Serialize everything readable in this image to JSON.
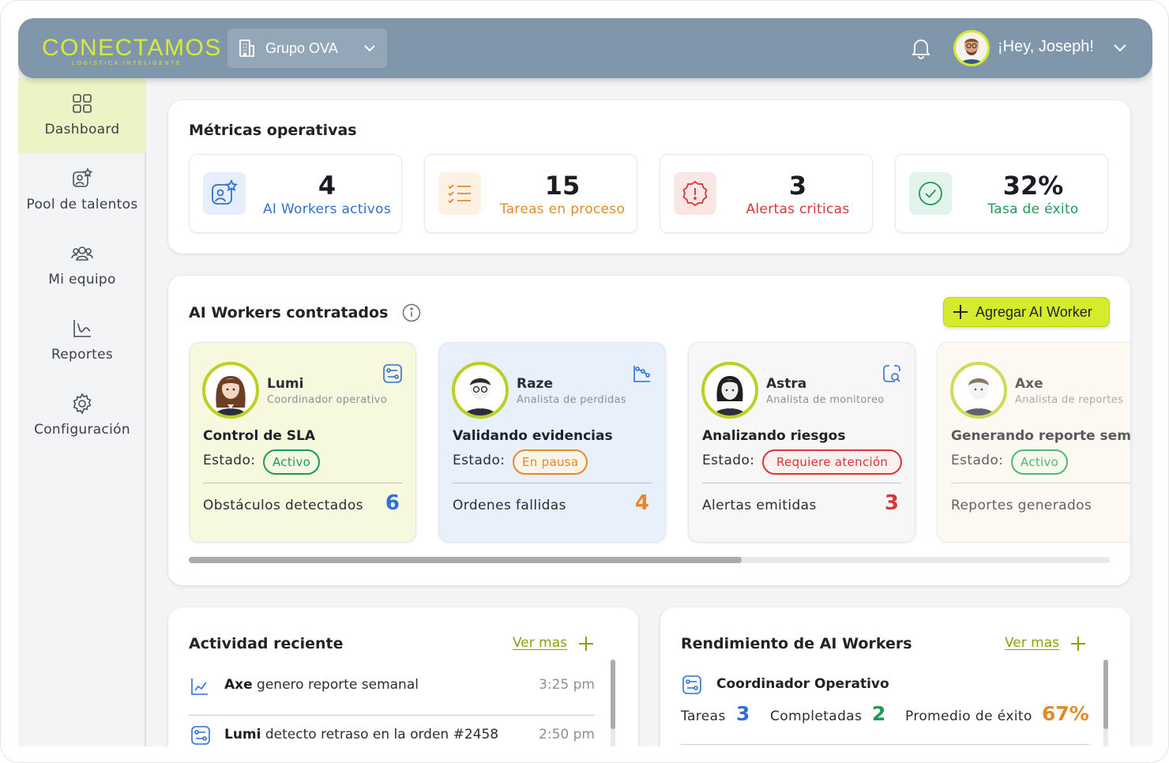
{
  "header": {
    "logo_text": "CONECTAMOS",
    "logo_tagline": "LOGISTICA INTELIGENTE",
    "org_name": "Grupo OVA",
    "greeting": "¡Hey, Joseph!"
  },
  "sidebar": {
    "items": [
      {
        "label": "Dashboard",
        "icon": "grid-icon",
        "active": true
      },
      {
        "label": "Pool de talentos",
        "icon": "user-star-icon",
        "active": false
      },
      {
        "label": "Mi equipo",
        "icon": "team-icon",
        "active": false
      },
      {
        "label": "Reportes",
        "icon": "chart-line-icon",
        "active": false
      },
      {
        "label": "Configuración",
        "icon": "gear-icon",
        "active": false
      }
    ]
  },
  "metrics": {
    "title": "Métricas operativas",
    "items": [
      {
        "value": "4",
        "label": "AI Workers activos",
        "color": "#2f6fd6",
        "icon": "user-star-icon"
      },
      {
        "value": "15",
        "label": "Tareas en proceso",
        "color": "#e58a2a",
        "icon": "checklist-icon"
      },
      {
        "value": "3",
        "label": "Alertas criticas",
        "color": "#d93636",
        "icon": "alert-badge-icon"
      },
      {
        "value": "32%",
        "label": "Tasa de éxito",
        "color": "#1f9a56",
        "icon": "check-circle-icon"
      }
    ]
  },
  "workers": {
    "title": "AI Workers contratados",
    "add_label": "Agregar AI Worker",
    "items": [
      {
        "name": "Lumi",
        "role": "Coordinador operativo",
        "task": "Control de SLA",
        "estado_label": "Estado:",
        "status": "Activo",
        "status_color": "#1f9a56",
        "stat_label": "Obstáculos detectados",
        "stat_value": "6",
        "stat_color": "#2f6fd6",
        "bg": "#f6f9de"
      },
      {
        "name": "Raze",
        "role": "Analista de perdidas",
        "task": "Validando evidencias",
        "estado_label": "Estado:",
        "status": "En pausa",
        "status_color": "#e58a2a",
        "stat_label": "Ordenes fallidas",
        "stat_value": "4",
        "stat_color": "#e58a2a",
        "bg": "#e8f0fb"
      },
      {
        "name": "Astra",
        "role": "Analista de monitoreo",
        "task": "Analizando riesgos",
        "estado_label": "Estado:",
        "status": "Requiere atención",
        "status_color": "#d93636",
        "stat_label": "Alertas emitidas",
        "stat_value": "3",
        "stat_color": "#d93636",
        "bg": "#f7f7f8"
      },
      {
        "name": "Axe",
        "role": "Analista de reportes",
        "task": "Generando reporte semanal",
        "estado_label": "Estado:",
        "status": "Activo",
        "status_color": "#1f9a56",
        "stat_label": "Reportes generados",
        "stat_value": "",
        "stat_color": "#2f6fd6",
        "bg": "#fdf6ee"
      }
    ],
    "scroll_fraction": 0.6
  },
  "activity": {
    "title": "Actividad reciente",
    "ver_mas": "Ver mas",
    "items": [
      {
        "actor": "Axe",
        "text": " genero reporte semanal",
        "time": "3:25 pm",
        "icon": "chart-line-icon"
      },
      {
        "actor": "Lumi",
        "text": " detecto retraso en la orden #2458",
        "time": "2:50 pm",
        "icon": "flow-icon"
      }
    ]
  },
  "performance": {
    "title": "Rendimiento de AI Workers",
    "ver_mas": "Ver mas",
    "group": "Coordinador Operativo",
    "tareas_label": "Tareas",
    "tareas_value": "3",
    "completadas_label": "Completadas",
    "completadas_value": "2",
    "promedio_label": "Promedio de éxito",
    "promedio_value": "67%"
  }
}
